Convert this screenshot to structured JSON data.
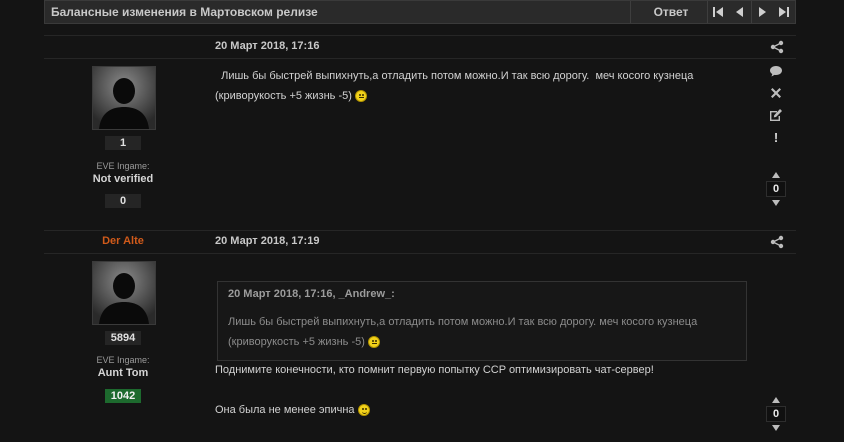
{
  "topbar": {
    "title": "Балансные изменения в Мартовском релизе",
    "reply_label": "Ответ",
    "nav_icons": [
      "first-page-icon",
      "prev-page-icon",
      "next-page-icon",
      "last-page-icon"
    ]
  },
  "posts": [
    {
      "author": "",
      "date": "20 Март 2018, 17:16",
      "post_count": "1",
      "eve_label": "EVE Ingame:",
      "eve_name": "Not verified",
      "reputation": "0",
      "text_line1": "  Лишь бы быстрей выпихнуть,а отладить потом можно.И так всю дорогу.  меч косого кузнеца",
      "text_line2": "(криворукость +5 жизнь -5)",
      "vote": "0"
    },
    {
      "author": "Der Alte",
      "date": "20 Март 2018, 17:19",
      "post_count": "5894",
      "eve_label": "EVE Ingame:",
      "eve_name": "Aunt Tom",
      "reputation": "1042",
      "quote": {
        "header": "20 Март 2018, 17:16, _Andrew_:",
        "line1": "Лишь бы быстрей выпихнуть,а отладить потом можно.И так всю дорогу.  меч косого кузнеца",
        "line2": "(криворукость +5 жизнь -5)"
      },
      "text_line1": "Поднимите конечности, кто помнит первую попытку CCP оптимизировать чат-сервер!",
      "text_line2": "Она была не менее эпична",
      "vote": "0"
    }
  ],
  "colors": {
    "background": "#141414",
    "author_accent": "#d05a1a",
    "reputation_green": "#1d6a2e"
  }
}
